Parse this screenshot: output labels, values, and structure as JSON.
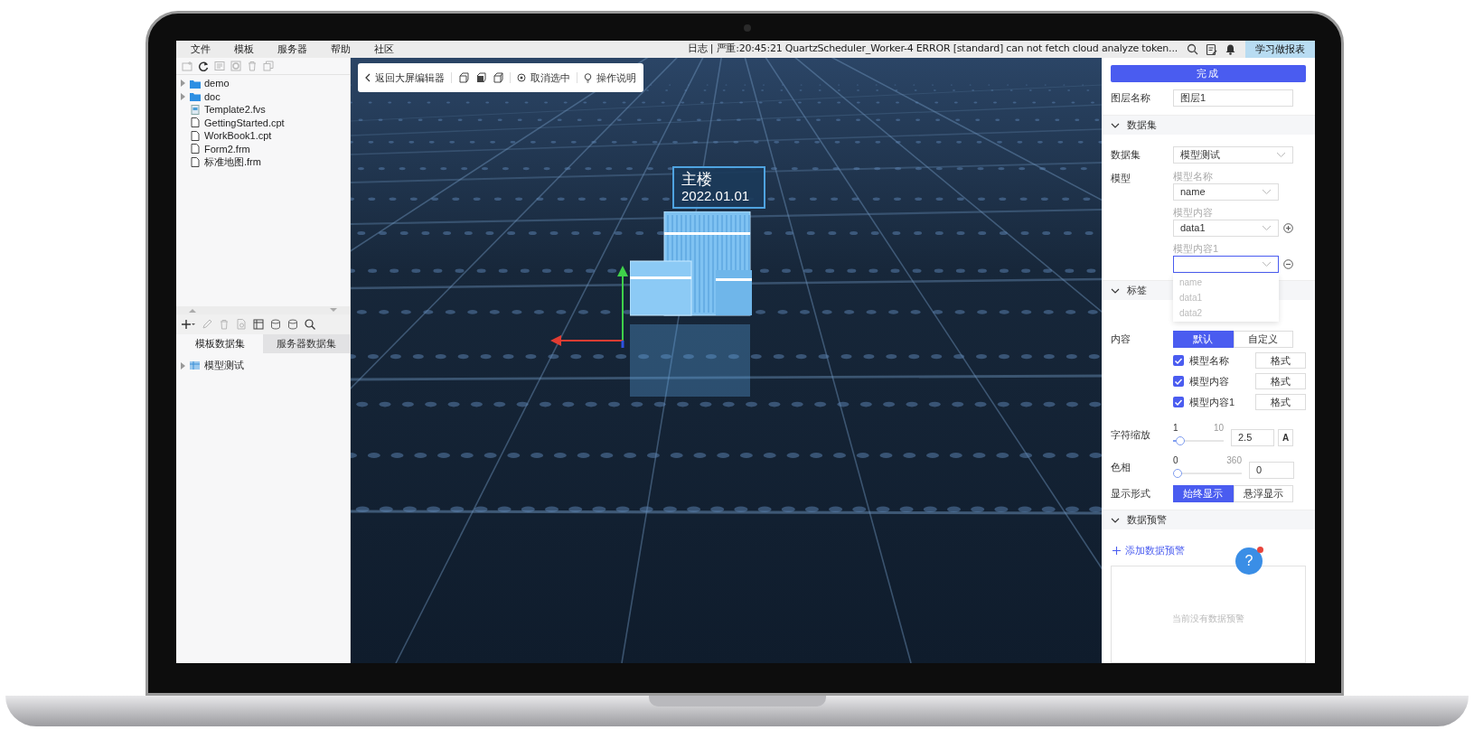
{
  "menu_bar": {
    "items": [
      "文件",
      "模板",
      "服务器",
      "帮助",
      "社区"
    ],
    "log": "日志 | 严重:20:45:21 QuartzScheduler_Worker-4 ERROR [standard] can not fetch cloud analyze token...",
    "learn_button": "学习做报表"
  },
  "file_tree": [
    {
      "label": "demo",
      "kind": "folder",
      "expanded": false
    },
    {
      "label": "doc",
      "kind": "folder",
      "expanded": false
    },
    {
      "label": "Template2.fvs",
      "kind": "fvs"
    },
    {
      "label": "GettingStarted.cpt",
      "kind": "file"
    },
    {
      "label": "WorkBook1.cpt",
      "kind": "file"
    },
    {
      "label": "Form2.frm",
      "kind": "file"
    },
    {
      "label": "标准地图.frm",
      "kind": "file"
    }
  ],
  "dataset_tabs": [
    {
      "label": "模板数据集",
      "selected": true
    },
    {
      "label": "服务器数据集",
      "selected": false
    }
  ],
  "dataset_tree": [
    {
      "label": "模型测试",
      "expanded": false
    }
  ],
  "canvas": {
    "toolbar": {
      "back": "返回大屏编辑器",
      "deselect": "取消选中",
      "help": "操作说明"
    },
    "marker": {
      "title": "主楼",
      "date": "2022.01.01"
    }
  },
  "panel": {
    "done_button": "完成",
    "layer_name": {
      "label": "图层名称",
      "value": "图层1"
    },
    "dataset_section": {
      "title": "数据集",
      "expanded": true,
      "dataset": {
        "label": "数据集",
        "value": "模型测试"
      },
      "model": {
        "label": "模型",
        "fields": [
          {
            "label": "模型名称",
            "value": "name",
            "kind": "plain",
            "focused": false
          },
          {
            "label": "模型内容",
            "value": "data1",
            "kind": "add",
            "focused": false
          },
          {
            "label": "模型内容1",
            "kind": "remove",
            "focused": true
          }
        ]
      },
      "dropdown_options": [
        "name",
        "data1",
        "data2"
      ]
    },
    "label_section": {
      "title": "标签",
      "expanded": true,
      "content": {
        "label": "内容",
        "options": [
          {
            "label": "默认",
            "selected": true
          },
          {
            "label": "自定义",
            "selected": false
          }
        ]
      },
      "checks": [
        {
          "label": "模型名称",
          "checked": true,
          "button": "格式"
        },
        {
          "label": "模型内容",
          "checked": true,
          "button": "格式"
        },
        {
          "label": "模型内容1",
          "checked": true,
          "button": "格式"
        }
      ],
      "font_scale": {
        "label": "字符缩放",
        "min": "1",
        "max": "10",
        "level": 0.06,
        "value": "2.5",
        "button": "A"
      },
      "hue": {
        "label": "色相",
        "min": "0",
        "max": "360",
        "level": 0,
        "value": "0"
      },
      "display_mode": {
        "label": "显示形式",
        "options": [
          {
            "label": "始终显示",
            "selected": true
          },
          {
            "label": "悬浮显示",
            "selected": false
          }
        ]
      }
    },
    "warning_section": {
      "title": "数据预警",
      "expanded": true,
      "add_link": "添加数据预警",
      "empty_text": "当前没有数据预警"
    },
    "help_fab": {
      "text": "?",
      "notification": true
    }
  }
}
